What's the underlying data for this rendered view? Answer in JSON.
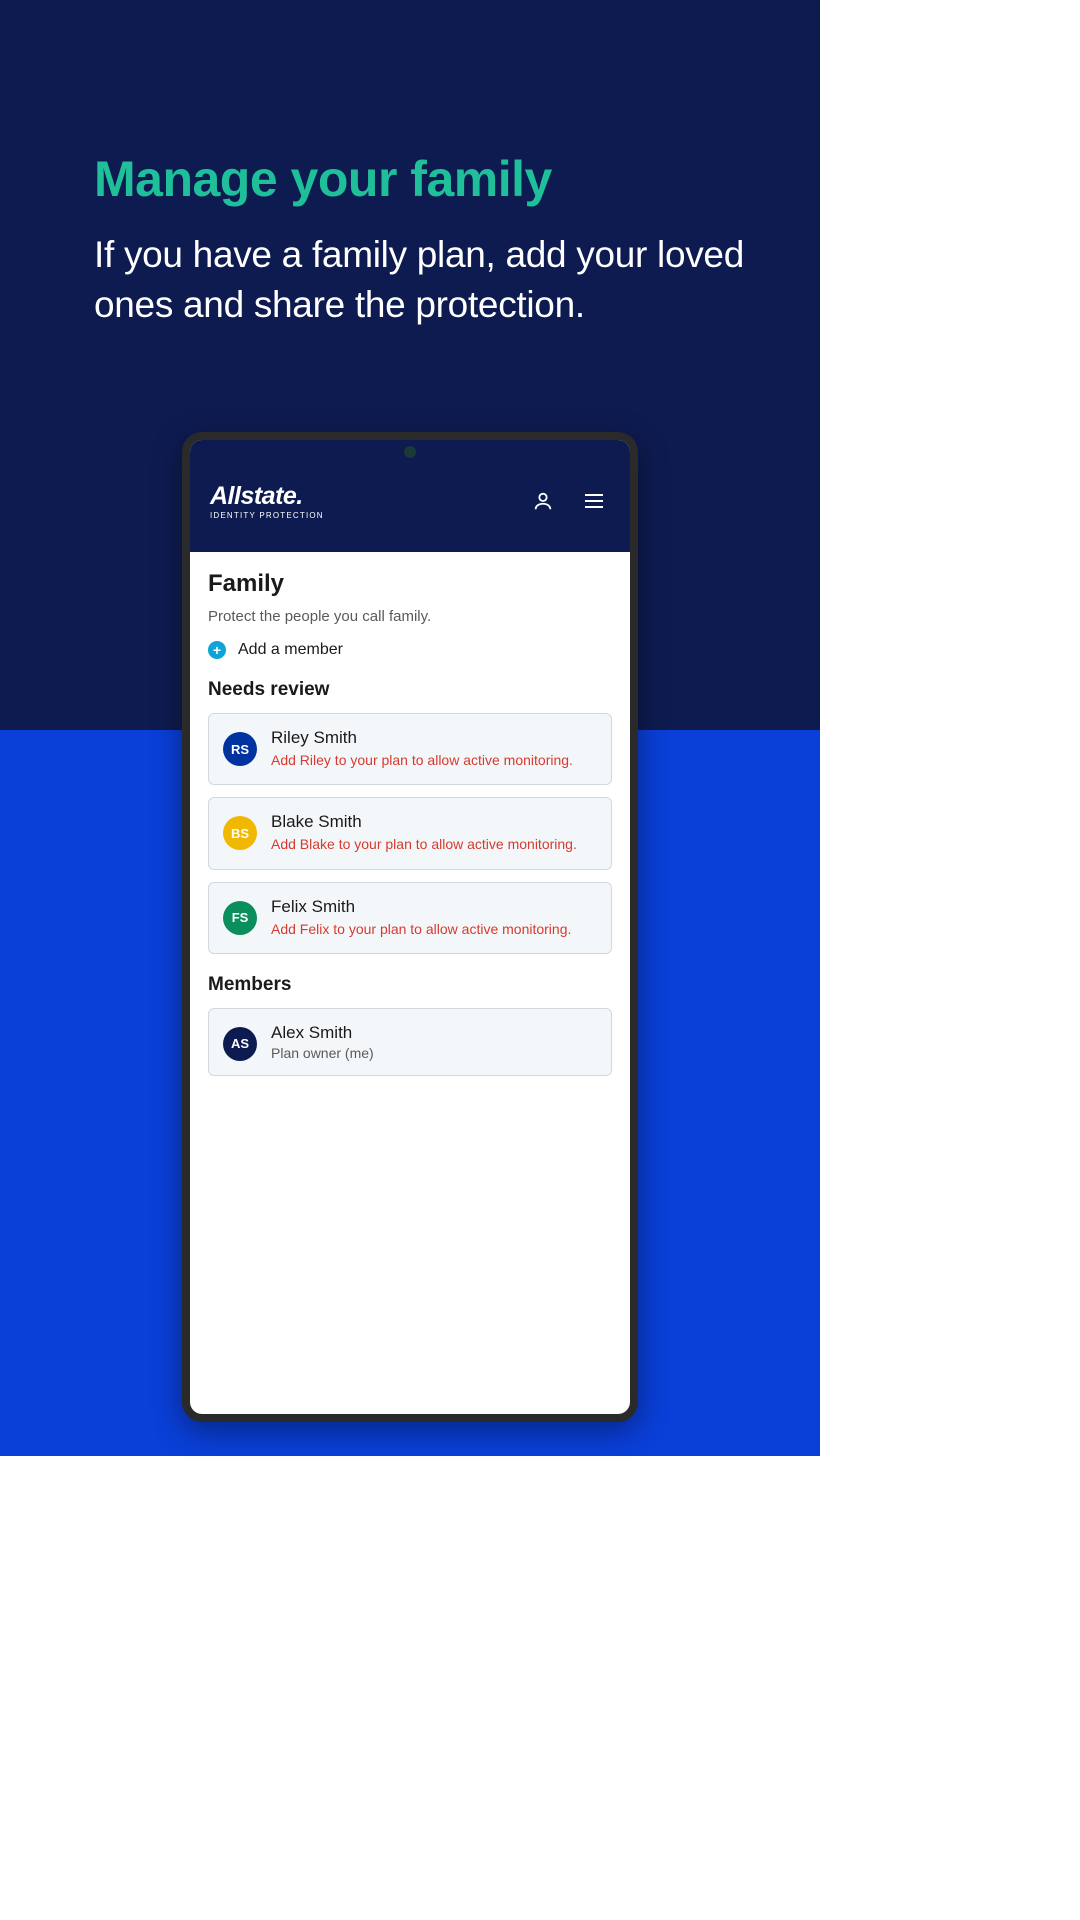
{
  "hero": {
    "title": "Manage your family",
    "subtitle": "If you have a family plan, add your loved ones and share the protection."
  },
  "app": {
    "brand": {
      "main": "Allstate.",
      "sub": "IDENTITY PROTECTION"
    },
    "page": {
      "title": "Family",
      "subtitle": "Protect the people you call family.",
      "add_label": "Add a member"
    },
    "sections": {
      "needs_review": {
        "title": "Needs review"
      },
      "members": {
        "title": "Members"
      }
    },
    "needs_review": [
      {
        "initials": "RS",
        "name": "Riley Smith",
        "message": "Add Riley to your plan to allow active monitoring.",
        "avatar_color": "blue"
      },
      {
        "initials": "BS",
        "name": "Blake Smith",
        "message": "Add Blake to your plan to allow active monitoring.",
        "avatar_color": "yellow"
      },
      {
        "initials": "FS",
        "name": "Felix Smith",
        "message": "Add Felix to your plan to allow active monitoring.",
        "avatar_color": "green"
      }
    ],
    "members": [
      {
        "initials": "AS",
        "name": "Alex Smith",
        "role": "Plan owner (me)",
        "avatar_color": "dark"
      }
    ]
  }
}
